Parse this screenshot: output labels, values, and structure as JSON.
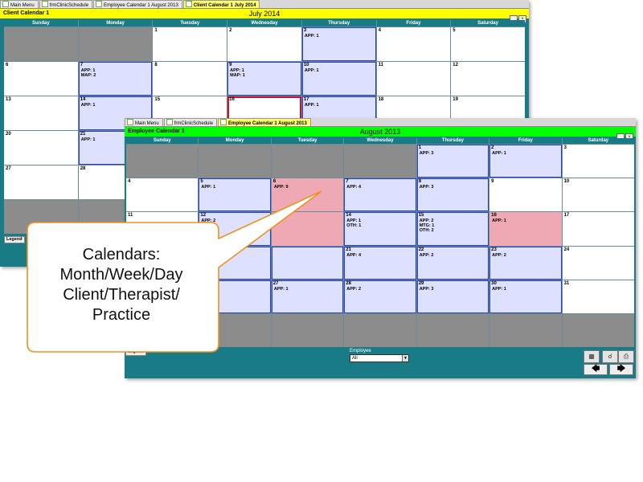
{
  "client_window": {
    "tabs": [
      {
        "label": "Main Menu"
      },
      {
        "label": "frmClinicSchedule"
      },
      {
        "label": "Employee Calendar 1 August  2013"
      },
      {
        "label": "Client Calendar 1 July  2014"
      }
    ],
    "window_title": "Client Calendar 1",
    "month_title": "July  2014",
    "day_headers": [
      "Sunday",
      "Monday",
      "Tuesday",
      "Wednesday",
      "Thursday",
      "Friday",
      "Saturday"
    ],
    "legend_label": "Legend"
  },
  "client_cells": [
    {
      "n": "",
      "s": "gray",
      "l": []
    },
    {
      "n": "",
      "s": "gray",
      "l": []
    },
    {
      "n": "1",
      "s": "",
      "l": []
    },
    {
      "n": "2",
      "s": "",
      "l": []
    },
    {
      "n": "3",
      "s": "appt",
      "l": [
        "APP: 1"
      ]
    },
    {
      "n": "4",
      "s": "",
      "l": []
    },
    {
      "n": "5",
      "s": "",
      "l": []
    },
    {
      "n": "6",
      "s": "",
      "l": []
    },
    {
      "n": "7",
      "s": "appt",
      "l": [
        "APP: 1",
        "MAP: 2"
      ]
    },
    {
      "n": "8",
      "s": "",
      "l": []
    },
    {
      "n": "9",
      "s": "appt",
      "l": [
        "APP: 1",
        "MAP: 1"
      ]
    },
    {
      "n": "10",
      "s": "appt",
      "l": [
        "APP: 1"
      ]
    },
    {
      "n": "11",
      "s": "",
      "l": []
    },
    {
      "n": "12",
      "s": "",
      "l": []
    },
    {
      "n": "13",
      "s": "",
      "l": []
    },
    {
      "n": "14",
      "s": "appt",
      "l": [
        "APP: 1"
      ]
    },
    {
      "n": "15",
      "s": "",
      "l": []
    },
    {
      "n": "16",
      "s": "today",
      "l": []
    },
    {
      "n": "17",
      "s": "appt",
      "l": [
        "APP: 1"
      ]
    },
    {
      "n": "18",
      "s": "",
      "l": []
    },
    {
      "n": "19",
      "s": "",
      "l": []
    },
    {
      "n": "20",
      "s": "",
      "l": []
    },
    {
      "n": "21",
      "s": "appt",
      "l": [
        "APP: 1"
      ]
    },
    {
      "n": "",
      "s": "",
      "l": []
    },
    {
      "n": "",
      "s": "",
      "l": []
    },
    {
      "n": "",
      "s": "",
      "l": []
    },
    {
      "n": "",
      "s": "",
      "l": []
    },
    {
      "n": "",
      "s": "",
      "l": []
    },
    {
      "n": "27",
      "s": "",
      "l": []
    },
    {
      "n": "28",
      "s": "",
      "l": []
    },
    {
      "n": "",
      "s": "",
      "l": []
    },
    {
      "n": "",
      "s": "",
      "l": []
    },
    {
      "n": "",
      "s": "",
      "l": []
    },
    {
      "n": "",
      "s": "",
      "l": []
    },
    {
      "n": "",
      "s": "",
      "l": []
    },
    {
      "n": "",
      "s": "gray",
      "l": []
    },
    {
      "n": "",
      "s": "gray",
      "l": []
    },
    {
      "n": "",
      "s": "gray",
      "l": []
    },
    {
      "n": "",
      "s": "gray",
      "l": []
    },
    {
      "n": "",
      "s": "gray",
      "l": []
    },
    {
      "n": "",
      "s": "gray",
      "l": []
    },
    {
      "n": "",
      "s": "gray",
      "l": []
    }
  ],
  "employee_window": {
    "tabs": [
      {
        "label": "Main Menu"
      },
      {
        "label": "frmClinicSchedule"
      },
      {
        "label": "Employee Calendar 1 August  2013"
      }
    ],
    "window_title": "Employee Calendar 1",
    "month_title": "August  2013",
    "day_headers": [
      "Sunday",
      "Monday",
      "Tuesday",
      "Wednesday",
      "Thursday",
      "Friday",
      "Saturday"
    ],
    "legend_label": "Legend",
    "employee_label": "Employee",
    "employee_value": "All",
    "nav_prev": "🡄",
    "nav_next": "🡆"
  },
  "employee_cells": [
    {
      "n": "",
      "s": "gray",
      "l": []
    },
    {
      "n": "",
      "s": "gray",
      "l": []
    },
    {
      "n": "",
      "s": "gray",
      "l": []
    },
    {
      "n": "",
      "s": "gray",
      "l": []
    },
    {
      "n": "1",
      "s": "appt",
      "l": [
        "APP: 3"
      ]
    },
    {
      "n": "2",
      "s": "appt",
      "l": [
        "APP: 1"
      ]
    },
    {
      "n": "3",
      "s": "",
      "l": []
    },
    {
      "n": "4",
      "s": "",
      "l": []
    },
    {
      "n": "5",
      "s": "appt",
      "l": [
        "APP: 1"
      ]
    },
    {
      "n": "6",
      "s": "pink",
      "l": [
        "APP: 9"
      ]
    },
    {
      "n": "7",
      "s": "appt",
      "l": [
        "APP: 4"
      ]
    },
    {
      "n": "8",
      "s": "appt",
      "l": [
        "APP: 3"
      ]
    },
    {
      "n": "9",
      "s": "",
      "l": []
    },
    {
      "n": "10",
      "s": "",
      "l": []
    },
    {
      "n": "11",
      "s": "",
      "l": []
    },
    {
      "n": "12",
      "s": "appt",
      "l": [
        "APP: 2"
      ]
    },
    {
      "n": "",
      "s": "pink",
      "l": []
    },
    {
      "n": "14",
      "s": "appt",
      "l": [
        "APP: 1",
        "OTH: 1"
      ]
    },
    {
      "n": "15",
      "s": "appt",
      "l": [
        "APP: 2",
        "MTG: 1",
        "OTH: 2"
      ]
    },
    {
      "n": "16",
      "s": "pink",
      "l": [
        "APP: 1"
      ]
    },
    {
      "n": "17",
      "s": "",
      "l": []
    },
    {
      "n": "",
      "s": "",
      "l": []
    },
    {
      "n": "",
      "s": "appt",
      "l": []
    },
    {
      "n": "",
      "s": "appt",
      "l": []
    },
    {
      "n": "21",
      "s": "appt",
      "l": [
        "APP: 4"
      ]
    },
    {
      "n": "22",
      "s": "appt",
      "l": [
        "APP: 2"
      ]
    },
    {
      "n": "23",
      "s": "appt",
      "l": [
        "APP: 2"
      ]
    },
    {
      "n": "24",
      "s": "",
      "l": []
    },
    {
      "n": "",
      "s": "",
      "l": []
    },
    {
      "n": "",
      "s": "appt",
      "l": []
    },
    {
      "n": "27",
      "s": "appt",
      "l": [
        "APP: 1"
      ]
    },
    {
      "n": "28",
      "s": "appt",
      "l": [
        "APP: 2"
      ]
    },
    {
      "n": "29",
      "s": "appt",
      "l": [
        "APP: 3"
      ]
    },
    {
      "n": "30",
      "s": "appt",
      "l": [
        "APP: 1"
      ]
    },
    {
      "n": "31",
      "s": "",
      "l": []
    },
    {
      "n": "",
      "s": "gray",
      "l": []
    },
    {
      "n": "",
      "s": "gray",
      "l": []
    },
    {
      "n": "",
      "s": "gray",
      "l": []
    },
    {
      "n": "",
      "s": "gray",
      "l": []
    },
    {
      "n": "",
      "s": "gray",
      "l": []
    },
    {
      "n": "",
      "s": "gray",
      "l": []
    },
    {
      "n": "",
      "s": "gray",
      "l": []
    }
  ],
  "callout": {
    "text": "Calendars:\nMonth/Week/Day\nClient/Therapist/\nPractice"
  },
  "colors": {
    "teal": "#187b86",
    "appt_fill": "#dde0ff",
    "busy_fill": "#efa9b4",
    "callout_border": "#f0901e"
  }
}
